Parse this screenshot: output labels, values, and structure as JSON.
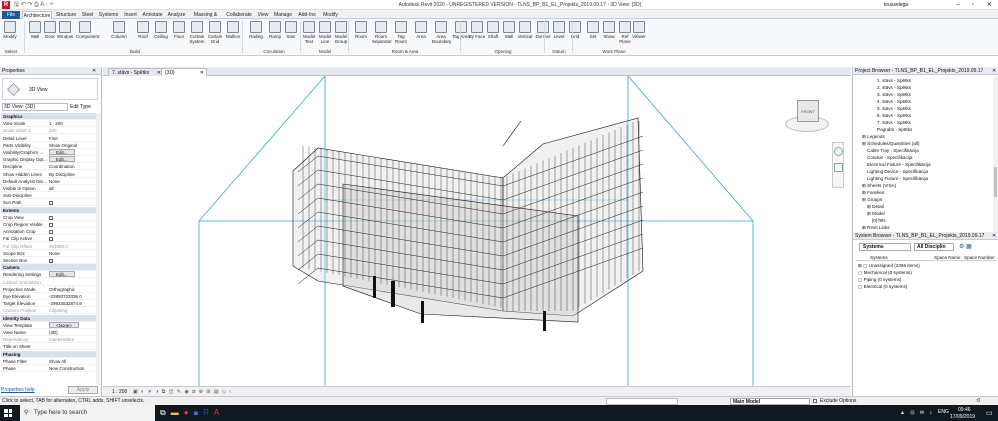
{
  "title_bar": {
    "title": "Autodesk Revit 2020 - UNREGISTERED VERSION - TLNS_BP_B1_EL_Projekts_2019.09.17 - 3D View: {3D}",
    "user": "krusselega"
  },
  "ribbon_tabs": [
    "File",
    "Architecture",
    "Structure",
    "Steel",
    "Systems",
    "Insert",
    "Annotate",
    "Analyze",
    "Massing & Site",
    "Collaborate",
    "View",
    "Manage",
    "Add-Ins",
    "Modify"
  ],
  "ribbon_tools": {
    "modify": "Modify",
    "select": "Select",
    "build": [
      "Wall",
      "Door",
      "Window",
      "Component",
      "Column",
      "Roof",
      "Ceiling",
      "Floor",
      "Curtain System",
      "Curtain Grid",
      "Mullion"
    ],
    "circulation": [
      "Railing",
      "Ramp",
      "Stair"
    ],
    "model": [
      "Model Text",
      "Model Line",
      "Model Group"
    ],
    "room_area": [
      "Room",
      "Room Separator",
      "Tag Room",
      "Area",
      "Area Boundary",
      "Tag Area"
    ],
    "opening": [
      "By Face",
      "Shaft",
      "Wall",
      "Vertical",
      "Dormer"
    ],
    "datum": [
      "Level",
      "Grid"
    ],
    "work_plane": [
      "Set",
      "Show",
      "Ref Plane",
      "Viewer"
    ]
  },
  "ribbon_groups": [
    "Select",
    "Build",
    "Circulation",
    "Model",
    "Room & Area",
    "Opening",
    "Datum",
    "Work Plane"
  ],
  "properties": {
    "header": "Properties",
    "type_name": "3D View",
    "selector": "3D View: {3D}",
    "edit_type": "Edit Type",
    "help_link": "Properties help",
    "apply": "Apply",
    "rows": [
      {
        "k": "Graphics",
        "v": "",
        "cat": true
      },
      {
        "k": "View Scale",
        "v": "1 : 200"
      },
      {
        "k": "Scale Value   1:",
        "v": "200",
        "dim": true
      },
      {
        "k": "Detail Level",
        "v": "Fine"
      },
      {
        "k": "Parts Visibility",
        "v": "Show Original"
      },
      {
        "k": "Visibility/Graphics ...",
        "v": "Edit...",
        "btn": true
      },
      {
        "k": "Graphic Display Opt...",
        "v": "Edit...",
        "btn": true
      },
      {
        "k": "Discipline",
        "v": "Coordination"
      },
      {
        "k": "Show Hidden Lines",
        "v": "By Discipline"
      },
      {
        "k": "Default Analysis Dis...",
        "v": "None"
      },
      {
        "k": "Visible In Option",
        "v": "all"
      },
      {
        "k": "Sub-Discipline",
        "v": ""
      },
      {
        "k": "Sun Path",
        "v": "",
        "cb": true
      },
      {
        "k": "Extents",
        "v": "",
        "cat": true
      },
      {
        "k": "Crop View",
        "v": "",
        "cb": true
      },
      {
        "k": "Crop Region Visible",
        "v": "",
        "cb": true
      },
      {
        "k": "Annotation Crop",
        "v": "",
        "cb": true
      },
      {
        "k": "Far Clip Active",
        "v": "",
        "cb": true
      },
      {
        "k": "Far Clip Offset",
        "v": "304800.0",
        "dim": true
      },
      {
        "k": "Scope Box",
        "v": "None"
      },
      {
        "k": "Section Box",
        "v": "",
        "cb": true,
        "on": true
      },
      {
        "k": "Camera",
        "v": "",
        "cat": true
      },
      {
        "k": "Rendering Settings",
        "v": "Edit...",
        "btn": true
      },
      {
        "k": "Locked Orientation",
        "v": "",
        "dim": true
      },
      {
        "k": "Projection Mode",
        "v": "Orthographic"
      },
      {
        "k": "Eye Elevation",
        "v": "-22893723336.0"
      },
      {
        "k": "Target Elevation",
        "v": "-29934532874.8"
      },
      {
        "k": "Camera Position",
        "v": "Adjusting",
        "dim": true
      },
      {
        "k": "Identity Data",
        "v": "",
        "cat": true
      },
      {
        "k": "View Template",
        "v": "<None>",
        "btn": true
      },
      {
        "k": "View Name",
        "v": "{3D}"
      },
      {
        "k": "Dependency",
        "v": "Independent",
        "dim": true
      },
      {
        "k": "Title on Sheet",
        "v": ""
      },
      {
        "k": "Phasing",
        "v": "",
        "cat": true
      },
      {
        "k": "Phase Filter",
        "v": "Show All"
      },
      {
        "k": "Phase",
        "v": "New Construction"
      }
    ]
  },
  "view_tabs": [
    {
      "label": "7. stāvs - Spētks",
      "active": false
    },
    {
      "label": "{3D}",
      "active": true
    }
  ],
  "view_control": {
    "scale": "1 : 200"
  },
  "viewcube": {
    "face": "FRONT"
  },
  "project_browser": {
    "header": "Project Browser - TLNS_BP_B1_EL_Projekts_2019.09.17",
    "items": [
      {
        "label": "1. stāvs - Spētks",
        "indent": 4
      },
      {
        "label": "2. stāvs - Spētks",
        "indent": 4
      },
      {
        "label": "3. stāvs - Spētks",
        "indent": 4
      },
      {
        "label": "4. stāvs - Spētks",
        "indent": 4
      },
      {
        "label": "5. stāvs - Spētks",
        "indent": 4
      },
      {
        "label": "6. stāvs - Spētks",
        "indent": 4
      },
      {
        "label": "7. stāvs - Spētks",
        "indent": 4
      },
      {
        "label": "Pagrabs - Spētks",
        "indent": 4
      },
      {
        "label": "Legends",
        "indent": 1
      },
      {
        "label": "Schedules/Quantities (all)",
        "indent": 1
      },
      {
        "label": "Cable Tray - Specifikācija",
        "indent": 2
      },
      {
        "label": "Conduit - Specifikācija",
        "indent": 2
      },
      {
        "label": "Electrical Fixture - Specifikācija",
        "indent": 2
      },
      {
        "label": "Lighting Device - Specifikācija",
        "indent": 2
      },
      {
        "label": "Lighting Fixture - Specifikācija",
        "indent": 2
      },
      {
        "label": "Sheets (VISA)",
        "indent": 1
      },
      {
        "label": "Families",
        "indent": 1
      },
      {
        "label": "Groups",
        "indent": 1
      },
      {
        "label": "Detail",
        "indent": 2
      },
      {
        "label": "Model",
        "indent": 2
      },
      {
        "label": "[0] fēls",
        "indent": 3
      },
      {
        "label": "Revit Links",
        "indent": 1
      }
    ]
  },
  "system_browser": {
    "header": "System Browser - TLNS_BP_B1_EL_Projekts_2019.09.17",
    "view_select": "Systems",
    "discipline_select": "All Disciplin",
    "columns": [
      "Systems",
      "Space Name",
      "Space Number"
    ],
    "rows": [
      "Unassigned (2396 items)",
      "Mechanical (0 systems)",
      "Piping (0 systems)",
      "Electrical (0 systems)"
    ]
  },
  "status_bar": {
    "hint": "Click to select, TAB for alternates, CTRL adds, SHIFT unselects.",
    "model": "Main Model",
    "exclude": "Exclude Options",
    "filter_count": ":0"
  },
  "taskbar": {
    "search_placeholder": "Type here to search",
    "lang": "ENG",
    "time": "09:46",
    "date": "17/09/2019"
  },
  "colors": {
    "accent": "#1d5a9c",
    "section_box": "#2aa8d8",
    "model_lines": "#111111"
  }
}
